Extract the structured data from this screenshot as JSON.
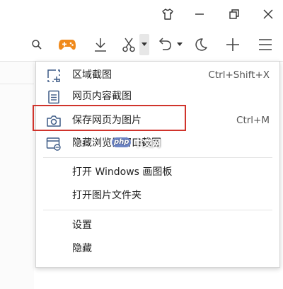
{
  "menu": {
    "items": [
      {
        "label": "区域截图",
        "shortcut": "Ctrl+Shift+X",
        "icon": "region-screenshot-icon"
      },
      {
        "label": "网页内容截图",
        "shortcut": "",
        "icon": "page-content-icon"
      },
      {
        "label": "保存网页为图片",
        "shortcut": "Ctrl+M",
        "icon": "camera-icon"
      },
      {
        "label": "隐藏浏览器窗口截图",
        "shortcut": "",
        "icon": "hidden-window-icon"
      },
      {
        "label": "打开 Windows 画图板",
        "shortcut": ""
      },
      {
        "label": "打开图片文件夹",
        "shortcut": ""
      },
      {
        "label": "设置",
        "shortcut": ""
      },
      {
        "label": "隐藏",
        "shortcut": ""
      }
    ]
  },
  "watermark": {
    "badge": "php",
    "text": "中文网"
  },
  "colors": {
    "highlight": "#d0342c",
    "gamepad": "#f08a1c",
    "watermark_badge": "#6e86c7"
  }
}
